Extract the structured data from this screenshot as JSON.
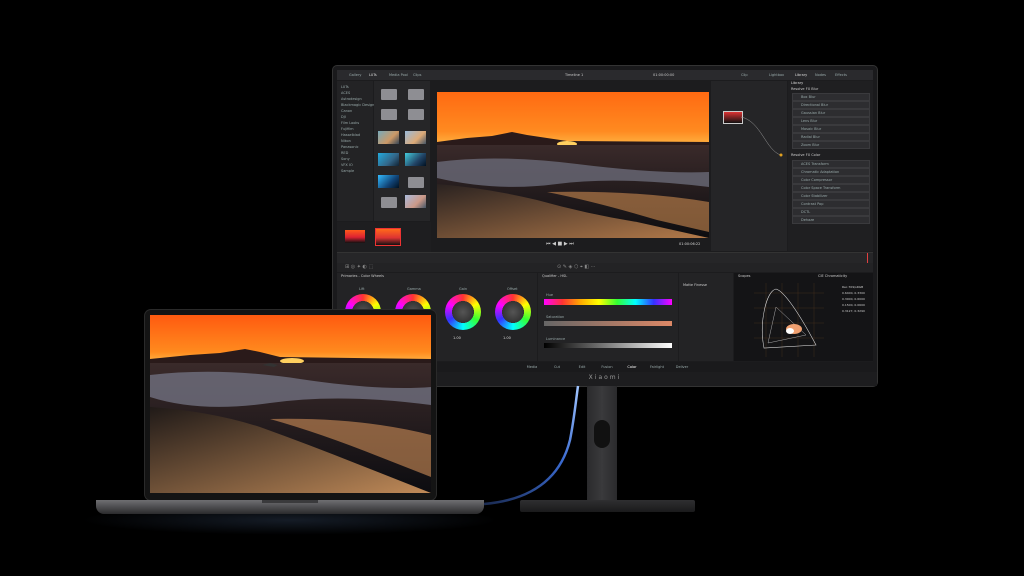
{
  "monitor": {
    "brand": "Xiaomi",
    "toolbar": {
      "left_items": [
        "Gallery",
        "LUTs",
        "Media Pool",
        "Clips"
      ],
      "center_title": "Timeline 1",
      "timecode": "01:00:00:00",
      "clip_label": "Clip",
      "right_items": [
        "Lightbox",
        "Library",
        "Nodes",
        "Effects"
      ]
    },
    "left_panel": {
      "items": [
        "LUTs",
        "ACES",
        "Astrodesign",
        "Blackmagic Design",
        "Canon",
        "DJI",
        "Film Looks",
        "Fujifilm",
        "Hasselblad",
        "Nikon",
        "Panasonic",
        "RED",
        "Sony",
        "VFX IO",
        "Sample"
      ]
    },
    "viewer": {
      "timecode": "01:00:06:22"
    },
    "effects_library": {
      "title": "Library",
      "section_fx": "Resolve FX Blur",
      "fx_items": [
        "Box Blur",
        "Directional Blur",
        "Gaussian Blur",
        "Lens Blur",
        "Mosaic Blur",
        "Radial Blur",
        "Zoom Blur"
      ],
      "section_color": "Resolve FX Color",
      "color_items": [
        "ACES Transform",
        "Chromatic Adaptation",
        "Color Compressor",
        "Color Space Transform",
        "Color Stabilizer",
        "Contrast Pop",
        "DCTL",
        "Dehaze"
      ]
    },
    "color_page": {
      "wheels_title": "Primaries - Color Wheels",
      "wheel_labels": [
        "Lift",
        "Gamma",
        "Gain",
        "Offset"
      ],
      "wheel_values": [
        "1.00",
        "1.00",
        "1.00",
        "1.00"
      ],
      "qualifier_title": "Qualifier - HSL",
      "qualifier_rows": [
        "Hue",
        "Saturation",
        "Luminance"
      ],
      "matte_title": "Matte Finesse",
      "scopes_title": "Scopes",
      "scopes_mode": "CIE Chromaticity",
      "scopes_legend": [
        "Rec.709/sRGB",
        "0.6400, 0.3300",
        "0.3000, 0.6000",
        "0.1500, 0.0600",
        "0.3127, 0.3290"
      ]
    },
    "bottom_nav": [
      "Media",
      "Cut",
      "Edit",
      "Fusion",
      "Color",
      "Fairlight",
      "Deliver"
    ],
    "bottom_nav_active": "Color"
  },
  "laptop": {
    "content": "beach sunset photo"
  },
  "colors": {
    "ui_bg": "#1c1c1e",
    "accent": "#e0a020",
    "playhead": "#e04040"
  }
}
